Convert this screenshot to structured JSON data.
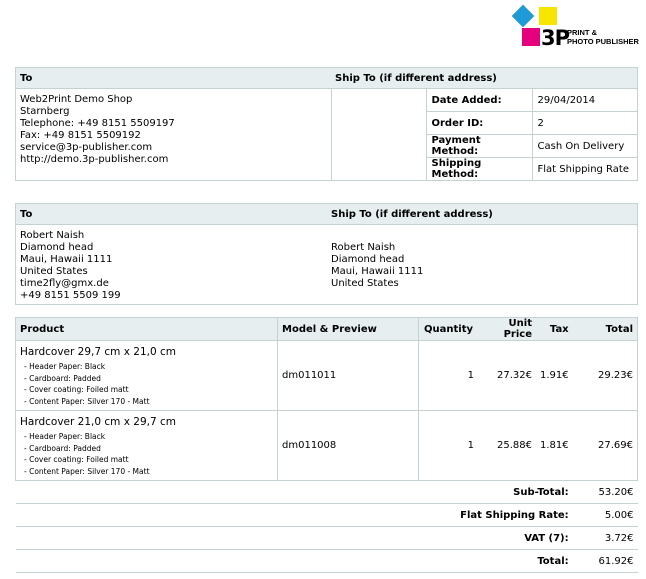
{
  "logo": {
    "mark": "3P",
    "line1": "PRINT &",
    "line2": "PHOTO PUBLISHER"
  },
  "section1": {
    "to_header": "To",
    "ship_header": "Ship To (if different address)",
    "to_lines": [
      "Web2Print Demo Shop",
      "Starnberg",
      "Telephone: +49 8151 5509197",
      "Fax: +49 8151 5509192",
      "service@3p-publisher.com",
      "http://demo.3p-publisher.com"
    ],
    "details": [
      {
        "label": "Date Added:",
        "value": "29/04/2014"
      },
      {
        "label": "Order ID:",
        "value": "2"
      },
      {
        "label": "Payment Method:",
        "value": "Cash On Delivery"
      },
      {
        "label": "Shipping Method:",
        "value": "Flat Shipping Rate"
      }
    ]
  },
  "section2": {
    "to_header": "To",
    "ship_header": "Ship To (if different address)",
    "to_lines": [
      "Robert Naish",
      "Diamond head",
      "Maui, Hawaii 1111",
      "United States",
      "time2fly@gmx.de",
      "+49 8151 5509 199"
    ],
    "ship_lines": [
      "Robert Naish",
      "Diamond head",
      "Maui, Hawaii 1111",
      "United States"
    ]
  },
  "products": {
    "headers": [
      "Product",
      "Model & Preview",
      "Quantity",
      "Unit Price",
      "Tax",
      "Total"
    ],
    "items": [
      {
        "name": "Hardcover 29,7 cm x 21,0 cm",
        "options": [
          "- Header Paper: Black",
          "- Cardboard: Padded",
          "- Cover coating: Foiled matt",
          "- Content Paper: Silver 170 - Matt"
        ],
        "model": "dm011011",
        "quantity": "1",
        "unit_price": "27.32€",
        "tax": "1.91€",
        "total": "29.23€"
      },
      {
        "name": "Hardcover 21,0 cm x 29,7 cm",
        "options": [
          "- Header Paper: Black",
          "- Cardboard: Padded",
          "- Cover coating: Foiled matt",
          "- Content Paper: Silver 170 - Matt"
        ],
        "model": "dm011008",
        "quantity": "1",
        "unit_price": "25.88€",
        "tax": "1.81€",
        "total": "27.69€"
      }
    ],
    "totals": [
      {
        "label": "Sub-Total:",
        "value": "53.20€"
      },
      {
        "label": "Flat Shipping Rate:",
        "value": "5.00€"
      },
      {
        "label": "VAT (7):",
        "value": "3.72€"
      },
      {
        "label": "Total:",
        "value": "61.92€"
      }
    ]
  }
}
